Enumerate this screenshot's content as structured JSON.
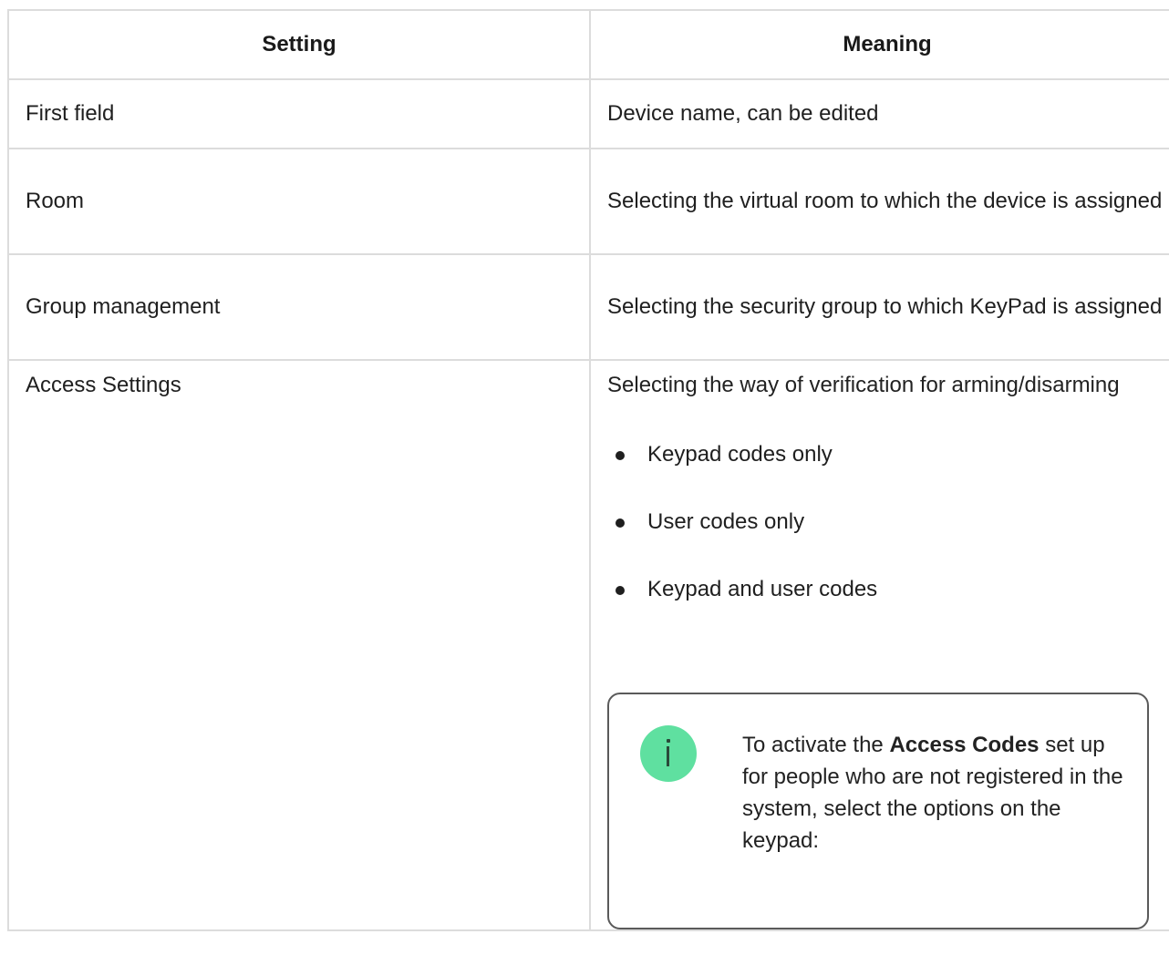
{
  "table": {
    "headers": [
      "Setting",
      "Meaning"
    ],
    "rows": [
      {
        "setting": "First field",
        "meaning": "Device name, can be edited"
      },
      {
        "setting": "Room",
        "meaning": "Selecting the virtual room to which the device is assigned"
      },
      {
        "setting": "Group management",
        "meaning": "Selecting the security group to which KeyPad is assigned"
      },
      {
        "setting": "Access Settings",
        "meaning": "Selecting the way of verification for arming/disarming"
      }
    ],
    "access_options": [
      "Keypad codes only",
      "User codes only",
      "Keypad and user codes"
    ]
  },
  "note": {
    "icon": "info-icon",
    "accent_color": "#5fe0a0",
    "text_before": "To activate the ",
    "text_bold": "Access Codes",
    "text_after": " set up for people who are not registered in the system, select the options on the keypad:"
  }
}
